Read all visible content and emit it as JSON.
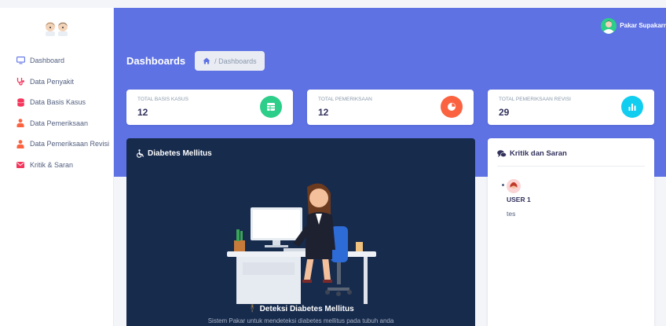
{
  "sidebar": {
    "items": [
      {
        "label": "Dashboard",
        "icon": "monitor-icon",
        "color": "#5e72e4"
      },
      {
        "label": "Data Penyakit",
        "icon": "stethoscope-icon",
        "color": "#f5365c"
      },
      {
        "label": "Data Basis Kasus",
        "icon": "database-icon",
        "color": "#f5365c"
      },
      {
        "label": "Data Pemeriksaan",
        "icon": "user-doctor-icon",
        "color": "#fb6340"
      },
      {
        "label": "Data Pemeriksaan Revisi",
        "icon": "user-doctor-icon",
        "color": "#fb6340"
      },
      {
        "label": "Kritik & Saran",
        "icon": "envelope-icon",
        "color": "#f5365c"
      }
    ]
  },
  "topbar": {
    "user_name": "Pakar Supakarr"
  },
  "header": {
    "title": "Dashboards",
    "breadcrumb": "/ Dashboards"
  },
  "stats": [
    {
      "label": "TOTAL BASIS KASUS",
      "value": "12",
      "icon": "table-icon",
      "color": "#2dce89"
    },
    {
      "label": "TOTAL PEMERIKSAAN",
      "value": "12",
      "icon": "pie-chart-icon",
      "color": "#fb6340"
    },
    {
      "label": "TOTAL PEMERIKSAAN REVISI",
      "value": "29",
      "icon": "bar-chart-icon",
      "color": "#11cdef"
    }
  ],
  "diabetes_card": {
    "title": "Diabetes Mellitus",
    "footer_title": "Deteksi Diabetes Mellitus",
    "footer_desc": "Sistem Pakar untuk mendeteksi diabetes mellitus pada tubuh anda"
  },
  "feedback_card": {
    "title": "Kritik dan Saran",
    "comments": [
      {
        "user": "USER 1",
        "text": "tes"
      }
    ]
  },
  "colors": {
    "primary": "#5e72e4",
    "dark": "#172b4d"
  }
}
